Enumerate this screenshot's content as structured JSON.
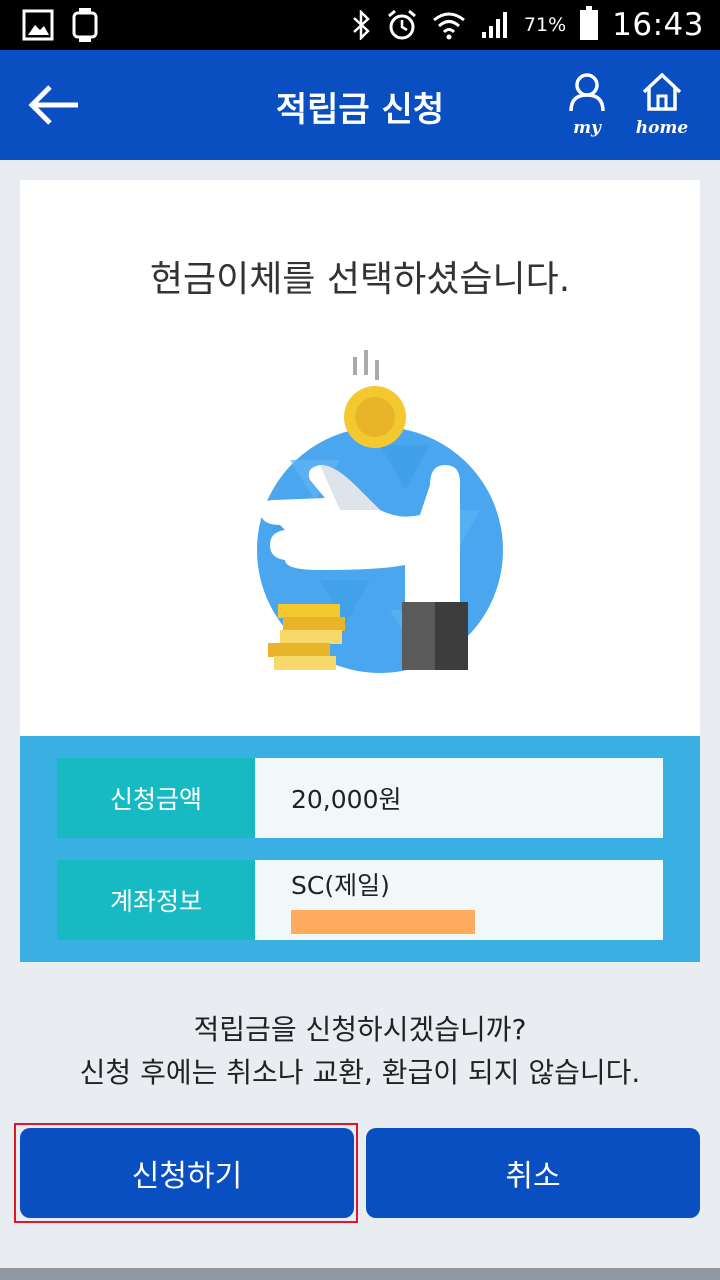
{
  "status_bar": {
    "battery": "71%",
    "time": "16:43",
    "left_icons": [
      "gallery-icon",
      "watch-icon"
    ],
    "right_icons": [
      "bluetooth-icon",
      "alarm-icon",
      "wifi-icon",
      "signal-icon",
      "battery-icon"
    ]
  },
  "app_bar": {
    "title": "적립금 신청",
    "my_label": "my",
    "home_label": "home"
  },
  "card": {
    "headline": "현금이체를 선택하셨습니다."
  },
  "info": {
    "rows": [
      {
        "label": "신청금액",
        "value": "20,000원"
      },
      {
        "label": "계좌정보",
        "value": "SC(제일)"
      }
    ]
  },
  "confirm": {
    "line1": "적립금을 신청하시겠습니까?",
    "line2": "신청 후에는 취소나 교환, 환급이 되지 않습니다."
  },
  "buttons": {
    "apply": "신청하기",
    "cancel": "취소"
  },
  "colors": {
    "brand_blue": "#0a4fc1",
    "info_bg": "#3aafe2",
    "label_teal": "#17b9c2",
    "highlight_red": "#e0162b",
    "redaction": "#ffaa5c"
  }
}
